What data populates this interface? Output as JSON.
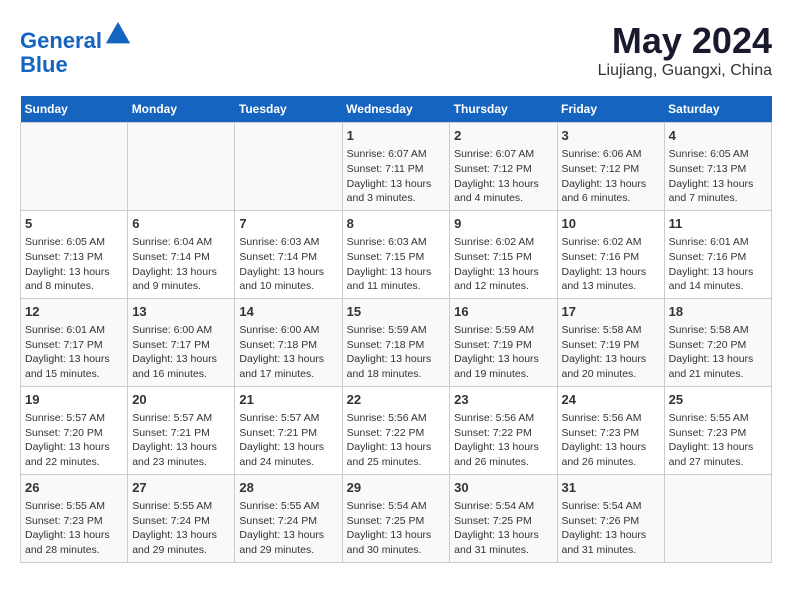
{
  "header": {
    "logo_line1": "General",
    "logo_line2": "Blue",
    "title": "May 2024",
    "subtitle": "Liujiang, Guangxi, China"
  },
  "weekdays": [
    "Sunday",
    "Monday",
    "Tuesday",
    "Wednesday",
    "Thursday",
    "Friday",
    "Saturday"
  ],
  "weeks": [
    [
      {
        "day": "",
        "info": ""
      },
      {
        "day": "",
        "info": ""
      },
      {
        "day": "",
        "info": ""
      },
      {
        "day": "1",
        "info": "Sunrise: 6:07 AM\nSunset: 7:11 PM\nDaylight: 13 hours and 3 minutes."
      },
      {
        "day": "2",
        "info": "Sunrise: 6:07 AM\nSunset: 7:12 PM\nDaylight: 13 hours and 4 minutes."
      },
      {
        "day": "3",
        "info": "Sunrise: 6:06 AM\nSunset: 7:12 PM\nDaylight: 13 hours and 6 minutes."
      },
      {
        "day": "4",
        "info": "Sunrise: 6:05 AM\nSunset: 7:13 PM\nDaylight: 13 hours and 7 minutes."
      }
    ],
    [
      {
        "day": "5",
        "info": "Sunrise: 6:05 AM\nSunset: 7:13 PM\nDaylight: 13 hours and 8 minutes."
      },
      {
        "day": "6",
        "info": "Sunrise: 6:04 AM\nSunset: 7:14 PM\nDaylight: 13 hours and 9 minutes."
      },
      {
        "day": "7",
        "info": "Sunrise: 6:03 AM\nSunset: 7:14 PM\nDaylight: 13 hours and 10 minutes."
      },
      {
        "day": "8",
        "info": "Sunrise: 6:03 AM\nSunset: 7:15 PM\nDaylight: 13 hours and 11 minutes."
      },
      {
        "day": "9",
        "info": "Sunrise: 6:02 AM\nSunset: 7:15 PM\nDaylight: 13 hours and 12 minutes."
      },
      {
        "day": "10",
        "info": "Sunrise: 6:02 AM\nSunset: 7:16 PM\nDaylight: 13 hours and 13 minutes."
      },
      {
        "day": "11",
        "info": "Sunrise: 6:01 AM\nSunset: 7:16 PM\nDaylight: 13 hours and 14 minutes."
      }
    ],
    [
      {
        "day": "12",
        "info": "Sunrise: 6:01 AM\nSunset: 7:17 PM\nDaylight: 13 hours and 15 minutes."
      },
      {
        "day": "13",
        "info": "Sunrise: 6:00 AM\nSunset: 7:17 PM\nDaylight: 13 hours and 16 minutes."
      },
      {
        "day": "14",
        "info": "Sunrise: 6:00 AM\nSunset: 7:18 PM\nDaylight: 13 hours and 17 minutes."
      },
      {
        "day": "15",
        "info": "Sunrise: 5:59 AM\nSunset: 7:18 PM\nDaylight: 13 hours and 18 minutes."
      },
      {
        "day": "16",
        "info": "Sunrise: 5:59 AM\nSunset: 7:19 PM\nDaylight: 13 hours and 19 minutes."
      },
      {
        "day": "17",
        "info": "Sunrise: 5:58 AM\nSunset: 7:19 PM\nDaylight: 13 hours and 20 minutes."
      },
      {
        "day": "18",
        "info": "Sunrise: 5:58 AM\nSunset: 7:20 PM\nDaylight: 13 hours and 21 minutes."
      }
    ],
    [
      {
        "day": "19",
        "info": "Sunrise: 5:57 AM\nSunset: 7:20 PM\nDaylight: 13 hours and 22 minutes."
      },
      {
        "day": "20",
        "info": "Sunrise: 5:57 AM\nSunset: 7:21 PM\nDaylight: 13 hours and 23 minutes."
      },
      {
        "day": "21",
        "info": "Sunrise: 5:57 AM\nSunset: 7:21 PM\nDaylight: 13 hours and 24 minutes."
      },
      {
        "day": "22",
        "info": "Sunrise: 5:56 AM\nSunset: 7:22 PM\nDaylight: 13 hours and 25 minutes."
      },
      {
        "day": "23",
        "info": "Sunrise: 5:56 AM\nSunset: 7:22 PM\nDaylight: 13 hours and 26 minutes."
      },
      {
        "day": "24",
        "info": "Sunrise: 5:56 AM\nSunset: 7:23 PM\nDaylight: 13 hours and 26 minutes."
      },
      {
        "day": "25",
        "info": "Sunrise: 5:55 AM\nSunset: 7:23 PM\nDaylight: 13 hours and 27 minutes."
      }
    ],
    [
      {
        "day": "26",
        "info": "Sunrise: 5:55 AM\nSunset: 7:23 PM\nDaylight: 13 hours and 28 minutes."
      },
      {
        "day": "27",
        "info": "Sunrise: 5:55 AM\nSunset: 7:24 PM\nDaylight: 13 hours and 29 minutes."
      },
      {
        "day": "28",
        "info": "Sunrise: 5:55 AM\nSunset: 7:24 PM\nDaylight: 13 hours and 29 minutes."
      },
      {
        "day": "29",
        "info": "Sunrise: 5:54 AM\nSunset: 7:25 PM\nDaylight: 13 hours and 30 minutes."
      },
      {
        "day": "30",
        "info": "Sunrise: 5:54 AM\nSunset: 7:25 PM\nDaylight: 13 hours and 31 minutes."
      },
      {
        "day": "31",
        "info": "Sunrise: 5:54 AM\nSunset: 7:26 PM\nDaylight: 13 hours and 31 minutes."
      },
      {
        "day": "",
        "info": ""
      }
    ]
  ]
}
